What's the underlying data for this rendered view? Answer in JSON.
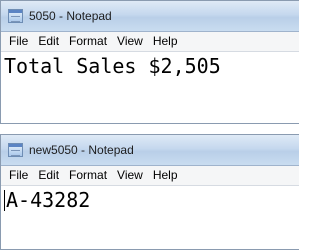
{
  "windows": [
    {
      "title": "5050 - Notepad",
      "menu": [
        "File",
        "Edit",
        "Format",
        "View",
        "Help"
      ],
      "content": "Total Sales $2,505"
    },
    {
      "title": "new5050 - Notepad",
      "menu": [
        "File",
        "Edit",
        "Format",
        "View",
        "Help"
      ],
      "content": "A-43282"
    }
  ]
}
